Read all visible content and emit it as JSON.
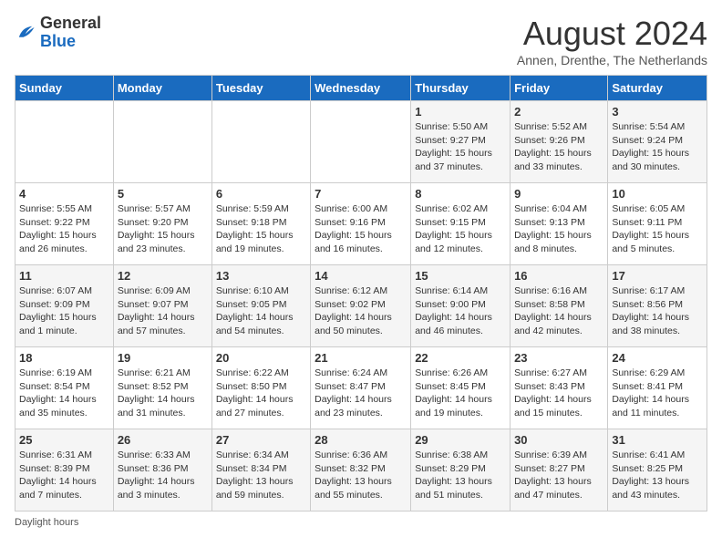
{
  "header": {
    "logo_general": "General",
    "logo_blue": "Blue",
    "month_title": "August 2024",
    "subtitle": "Annen, Drenthe, The Netherlands"
  },
  "days_of_week": [
    "Sunday",
    "Monday",
    "Tuesday",
    "Wednesday",
    "Thursday",
    "Friday",
    "Saturday"
  ],
  "weeks": [
    [
      {
        "day": "",
        "info": ""
      },
      {
        "day": "",
        "info": ""
      },
      {
        "day": "",
        "info": ""
      },
      {
        "day": "",
        "info": ""
      },
      {
        "day": "1",
        "info": "Sunrise: 5:50 AM\nSunset: 9:27 PM\nDaylight: 15 hours\nand 37 minutes."
      },
      {
        "day": "2",
        "info": "Sunrise: 5:52 AM\nSunset: 9:26 PM\nDaylight: 15 hours\nand 33 minutes."
      },
      {
        "day": "3",
        "info": "Sunrise: 5:54 AM\nSunset: 9:24 PM\nDaylight: 15 hours\nand 30 minutes."
      }
    ],
    [
      {
        "day": "4",
        "info": "Sunrise: 5:55 AM\nSunset: 9:22 PM\nDaylight: 15 hours\nand 26 minutes."
      },
      {
        "day": "5",
        "info": "Sunrise: 5:57 AM\nSunset: 9:20 PM\nDaylight: 15 hours\nand 23 minutes."
      },
      {
        "day": "6",
        "info": "Sunrise: 5:59 AM\nSunset: 9:18 PM\nDaylight: 15 hours\nand 19 minutes."
      },
      {
        "day": "7",
        "info": "Sunrise: 6:00 AM\nSunset: 9:16 PM\nDaylight: 15 hours\nand 16 minutes."
      },
      {
        "day": "8",
        "info": "Sunrise: 6:02 AM\nSunset: 9:15 PM\nDaylight: 15 hours\nand 12 minutes."
      },
      {
        "day": "9",
        "info": "Sunrise: 6:04 AM\nSunset: 9:13 PM\nDaylight: 15 hours\nand 8 minutes."
      },
      {
        "day": "10",
        "info": "Sunrise: 6:05 AM\nSunset: 9:11 PM\nDaylight: 15 hours\nand 5 minutes."
      }
    ],
    [
      {
        "day": "11",
        "info": "Sunrise: 6:07 AM\nSunset: 9:09 PM\nDaylight: 15 hours\nand 1 minute."
      },
      {
        "day": "12",
        "info": "Sunrise: 6:09 AM\nSunset: 9:07 PM\nDaylight: 14 hours\nand 57 minutes."
      },
      {
        "day": "13",
        "info": "Sunrise: 6:10 AM\nSunset: 9:05 PM\nDaylight: 14 hours\nand 54 minutes."
      },
      {
        "day": "14",
        "info": "Sunrise: 6:12 AM\nSunset: 9:02 PM\nDaylight: 14 hours\nand 50 minutes."
      },
      {
        "day": "15",
        "info": "Sunrise: 6:14 AM\nSunset: 9:00 PM\nDaylight: 14 hours\nand 46 minutes."
      },
      {
        "day": "16",
        "info": "Sunrise: 6:16 AM\nSunset: 8:58 PM\nDaylight: 14 hours\nand 42 minutes."
      },
      {
        "day": "17",
        "info": "Sunrise: 6:17 AM\nSunset: 8:56 PM\nDaylight: 14 hours\nand 38 minutes."
      }
    ],
    [
      {
        "day": "18",
        "info": "Sunrise: 6:19 AM\nSunset: 8:54 PM\nDaylight: 14 hours\nand 35 minutes."
      },
      {
        "day": "19",
        "info": "Sunrise: 6:21 AM\nSunset: 8:52 PM\nDaylight: 14 hours\nand 31 minutes."
      },
      {
        "day": "20",
        "info": "Sunrise: 6:22 AM\nSunset: 8:50 PM\nDaylight: 14 hours\nand 27 minutes."
      },
      {
        "day": "21",
        "info": "Sunrise: 6:24 AM\nSunset: 8:47 PM\nDaylight: 14 hours\nand 23 minutes."
      },
      {
        "day": "22",
        "info": "Sunrise: 6:26 AM\nSunset: 8:45 PM\nDaylight: 14 hours\nand 19 minutes."
      },
      {
        "day": "23",
        "info": "Sunrise: 6:27 AM\nSunset: 8:43 PM\nDaylight: 14 hours\nand 15 minutes."
      },
      {
        "day": "24",
        "info": "Sunrise: 6:29 AM\nSunset: 8:41 PM\nDaylight: 14 hours\nand 11 minutes."
      }
    ],
    [
      {
        "day": "25",
        "info": "Sunrise: 6:31 AM\nSunset: 8:39 PM\nDaylight: 14 hours\nand 7 minutes."
      },
      {
        "day": "26",
        "info": "Sunrise: 6:33 AM\nSunset: 8:36 PM\nDaylight: 14 hours\nand 3 minutes."
      },
      {
        "day": "27",
        "info": "Sunrise: 6:34 AM\nSunset: 8:34 PM\nDaylight: 13 hours\nand 59 minutes."
      },
      {
        "day": "28",
        "info": "Sunrise: 6:36 AM\nSunset: 8:32 PM\nDaylight: 13 hours\nand 55 minutes."
      },
      {
        "day": "29",
        "info": "Sunrise: 6:38 AM\nSunset: 8:29 PM\nDaylight: 13 hours\nand 51 minutes."
      },
      {
        "day": "30",
        "info": "Sunrise: 6:39 AM\nSunset: 8:27 PM\nDaylight: 13 hours\nand 47 minutes."
      },
      {
        "day": "31",
        "info": "Sunrise: 6:41 AM\nSunset: 8:25 PM\nDaylight: 13 hours\nand 43 minutes."
      }
    ]
  ],
  "footer": {
    "daylight_note": "Daylight hours"
  }
}
